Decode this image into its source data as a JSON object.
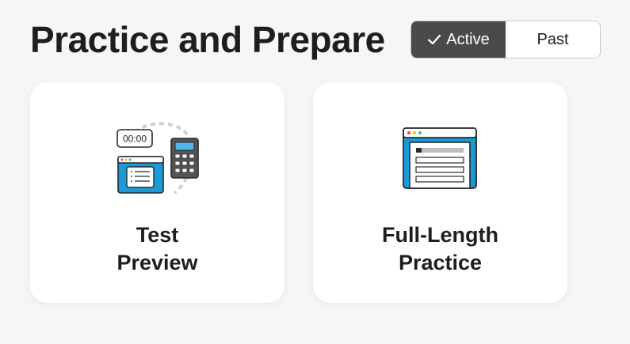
{
  "header": {
    "title": "Practice and Prepare"
  },
  "toggle": {
    "active_label": "Active",
    "past_label": "Past",
    "selected": "Active"
  },
  "cards": [
    {
      "title_line1": "Test",
      "title_line2": "Preview",
      "icon": "test-preview-icon",
      "timer_text": "00:00"
    },
    {
      "title_line1": "Full-Length",
      "title_line2": "Practice",
      "icon": "full-length-practice-icon"
    }
  ],
  "colors": {
    "accent_blue": "#1a9ad6",
    "active_toggle": "#4a4a4a",
    "background": "#f6f6f6"
  }
}
